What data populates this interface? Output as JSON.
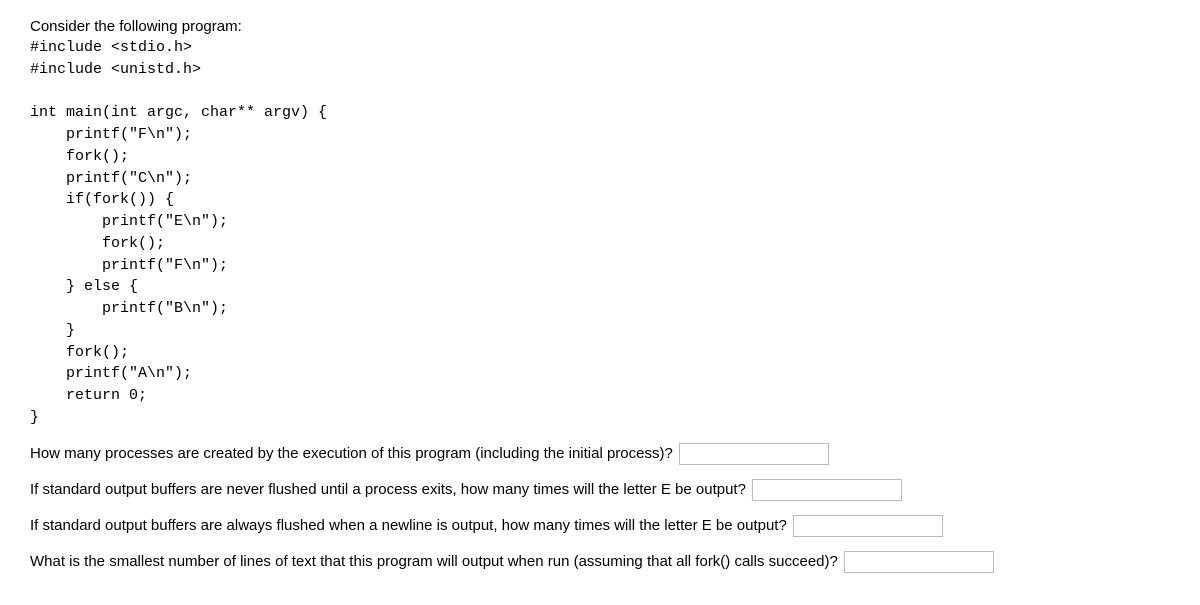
{
  "intro": "Consider the following program:",
  "code": "#include <stdio.h>\n#include <unistd.h>\n\nint main(int argc, char** argv) {\n    printf(\"F\\n\");\n    fork();\n    printf(\"C\\n\");\n    if(fork()) {\n        printf(\"E\\n\");\n        fork();\n        printf(\"F\\n\");\n    } else {\n        printf(\"B\\n\");\n    }\n    fork();\n    printf(\"A\\n\");\n    return 0;\n}",
  "questions": {
    "q1": "How many processes are created by the execution of this program (including the initial process)?",
    "q2": "If standard output buffers are never flushed until a process exits, how many times will the letter E be output?",
    "q3": "If standard output buffers are always flushed when a newline is output, how many times will the letter E be output?",
    "q4": "What is the smallest number of lines of text that this program will output when run (assuming that all fork() calls succeed)?"
  },
  "answers": {
    "q1": "",
    "q2": "",
    "q3": "",
    "q4": ""
  }
}
